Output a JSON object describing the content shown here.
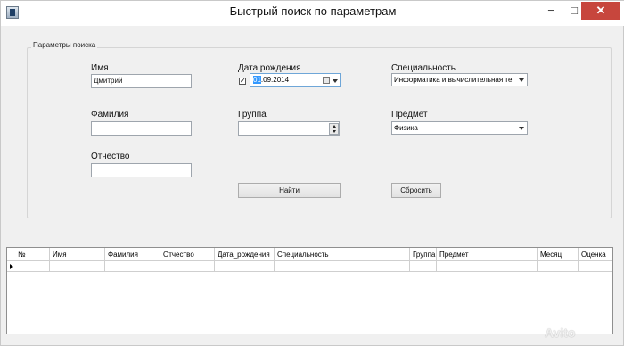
{
  "window": {
    "title": "Быстрый поиск по параметрам",
    "min_glyph": "−",
    "max_glyph": "□",
    "close_glyph": "✕"
  },
  "search_group": {
    "legend": "Параметры поиска",
    "first_name": {
      "label": "Имя",
      "value": "Дмитрий"
    },
    "last_name": {
      "label": "Фамилия",
      "value": ""
    },
    "patronymic": {
      "label": "Отчество",
      "value": ""
    },
    "birth_date": {
      "label": "Дата рождения",
      "checked": true,
      "check_glyph": "✓",
      "day": "01",
      "rest": ".09.2014"
    },
    "group": {
      "label": "Группа",
      "value": ""
    },
    "specialty": {
      "label": "Специальность",
      "selected": "Информатика и вычислительная те"
    },
    "subject": {
      "label": "Предмет",
      "selected": "Физика"
    },
    "find_button": "Найти",
    "reset_button": "Сбросить"
  },
  "grid": {
    "columns": [
      "№",
      "Имя",
      "Фамилия",
      "Отчество",
      "Дата_рождения",
      "Специальность",
      "Группа",
      "Предмет",
      "Месяц",
      "Оценка"
    ],
    "rows": [
      [
        "",
        "",
        "",
        "",
        "",
        "",
        "",
        "",
        "",
        ""
      ]
    ]
  },
  "watermark": "Avito"
}
